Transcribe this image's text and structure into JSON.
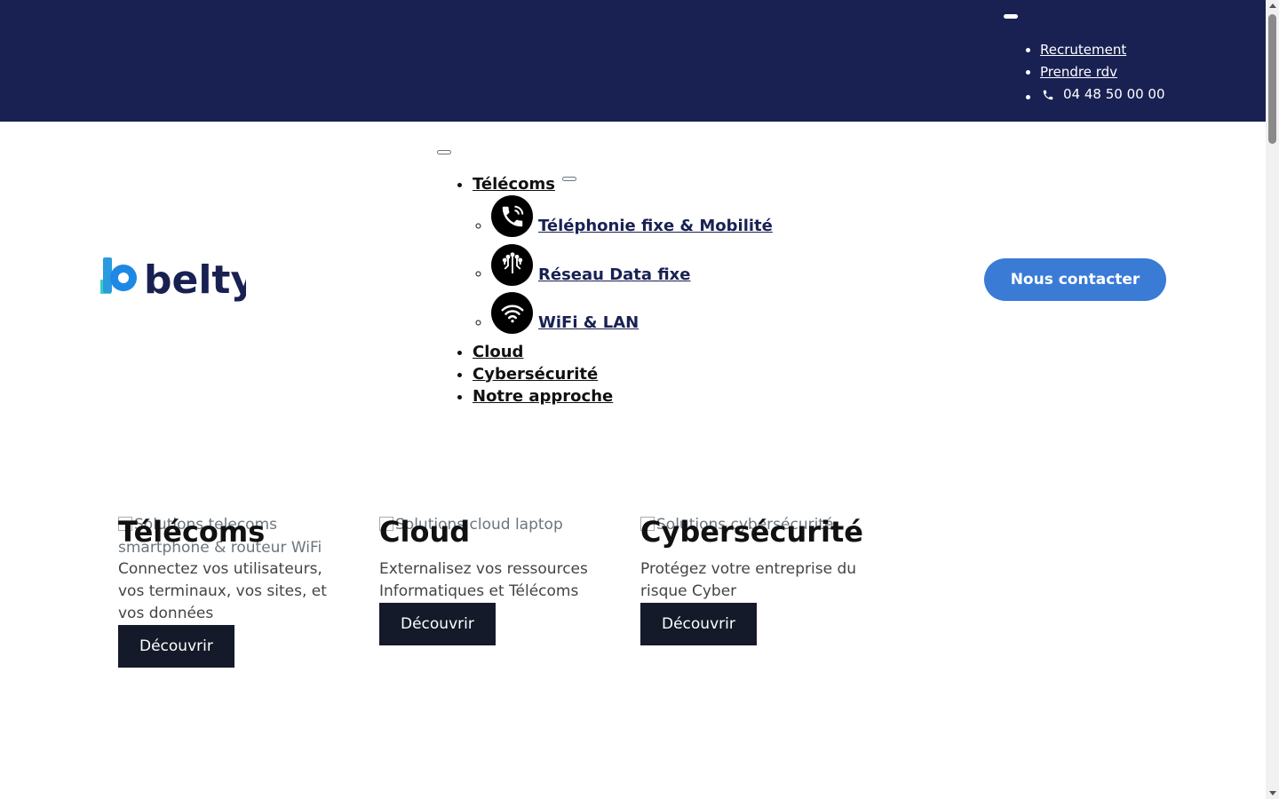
{
  "topbar": {
    "links": [
      {
        "label": "Recrutement"
      },
      {
        "label": "Prendre rdv"
      }
    ],
    "phone": "04 48 50 00 00"
  },
  "brand": {
    "name": "belty",
    "colors": {
      "navy": "#192153",
      "blue": "#3a7bd5",
      "teal": "#3ccfc0"
    }
  },
  "nav": {
    "items": [
      {
        "label": "Télécoms"
      },
      {
        "label": "Cloud"
      },
      {
        "label": "Cybersécurité"
      },
      {
        "label": "Notre approche"
      }
    ],
    "telecoms_sub": [
      {
        "label": "Téléphonie fixe & Mobilité",
        "icon": "phone-icon"
      },
      {
        "label": "Réseau Data fixe",
        "icon": "network-icon"
      },
      {
        "label": "WiFi & LAN",
        "icon": "wifi-icon"
      }
    ]
  },
  "header": {
    "contact_label": "Nous contacter"
  },
  "cards": [
    {
      "alt": "Solutions telecoms smartphone & routeur WiFi",
      "title": "Télécoms",
      "text": "Connectez vos utilisateurs, vos terminaux, vos sites, et vos données",
      "button": "Découvrir"
    },
    {
      "alt": "Solutions cloud laptop",
      "title": "Cloud",
      "text": "Externalisez vos ressources Informatiques et Télécoms",
      "button": "Découvrir"
    },
    {
      "alt": "Solutions cybersécurité",
      "title": "Cybersécurité",
      "text": "Protégez votre entreprise du risque Cyber",
      "button": "Découvrir"
    }
  ]
}
